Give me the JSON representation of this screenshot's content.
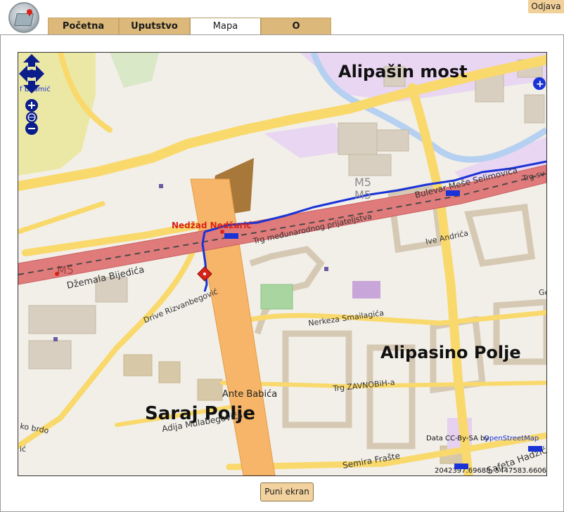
{
  "header": {
    "logout_label": "Odjava",
    "tabs": [
      {
        "label": "Početna"
      },
      {
        "label": "Uputstvo"
      },
      {
        "label": "Mapa",
        "active": true
      },
      {
        "label": "O"
      }
    ]
  },
  "map": {
    "places": {
      "alipasin_most": "Alipašin most",
      "alipasino_polje": "Alipasino Polje",
      "sarajpolje": "Saraj Polje"
    },
    "streets": {
      "dzemala_bijedica": "Džemala Bijedića",
      "trg_medunarodnog": "Trg međunarodnog prijateljstva",
      "bulevar_mese": "Bulevar Meše Selimovića",
      "trg_sv": "Trg sv",
      "ive_andrica": "Ive Andrića",
      "nerkeza": "Nerkeza Smailagića",
      "trg_zavnobih": "Trg ZAVNOBiH-a",
      "ante_babica": "Ante Babića",
      "adija": "Adija Mulabegovića",
      "semira_fraste": "Semira Frašte",
      "safeta_hadzica": "Safeta Hadžića",
      "drive_rizvanbegovic": "Drive Rizvanbegović",
      "ko_brdo": "ko brdo",
      "dzamic": "f Džamić",
      "g_label": "Ge",
      "ic_label": "ić",
      "m5_a": "M5",
      "m5_b": "M5",
      "m5_c": "M5",
      "trg_label": "Trg"
    },
    "marker_label": "Nedžad Nedžarić",
    "attribution": "Data CC-By-SA by ",
    "attribution_link": "OpenStreetMap",
    "coords": "2042397.69688, 5447583.66061"
  },
  "colors": {
    "tab_bg": "#dcb97a",
    "button_bg": "#f2d39f",
    "motorway": "#e07b7b",
    "primary_road": "#f9d96b",
    "trunk_road": "#f6b568",
    "route": "#1a33d6"
  },
  "controls": {
    "fullscreen_label": "Puni ekran"
  }
}
